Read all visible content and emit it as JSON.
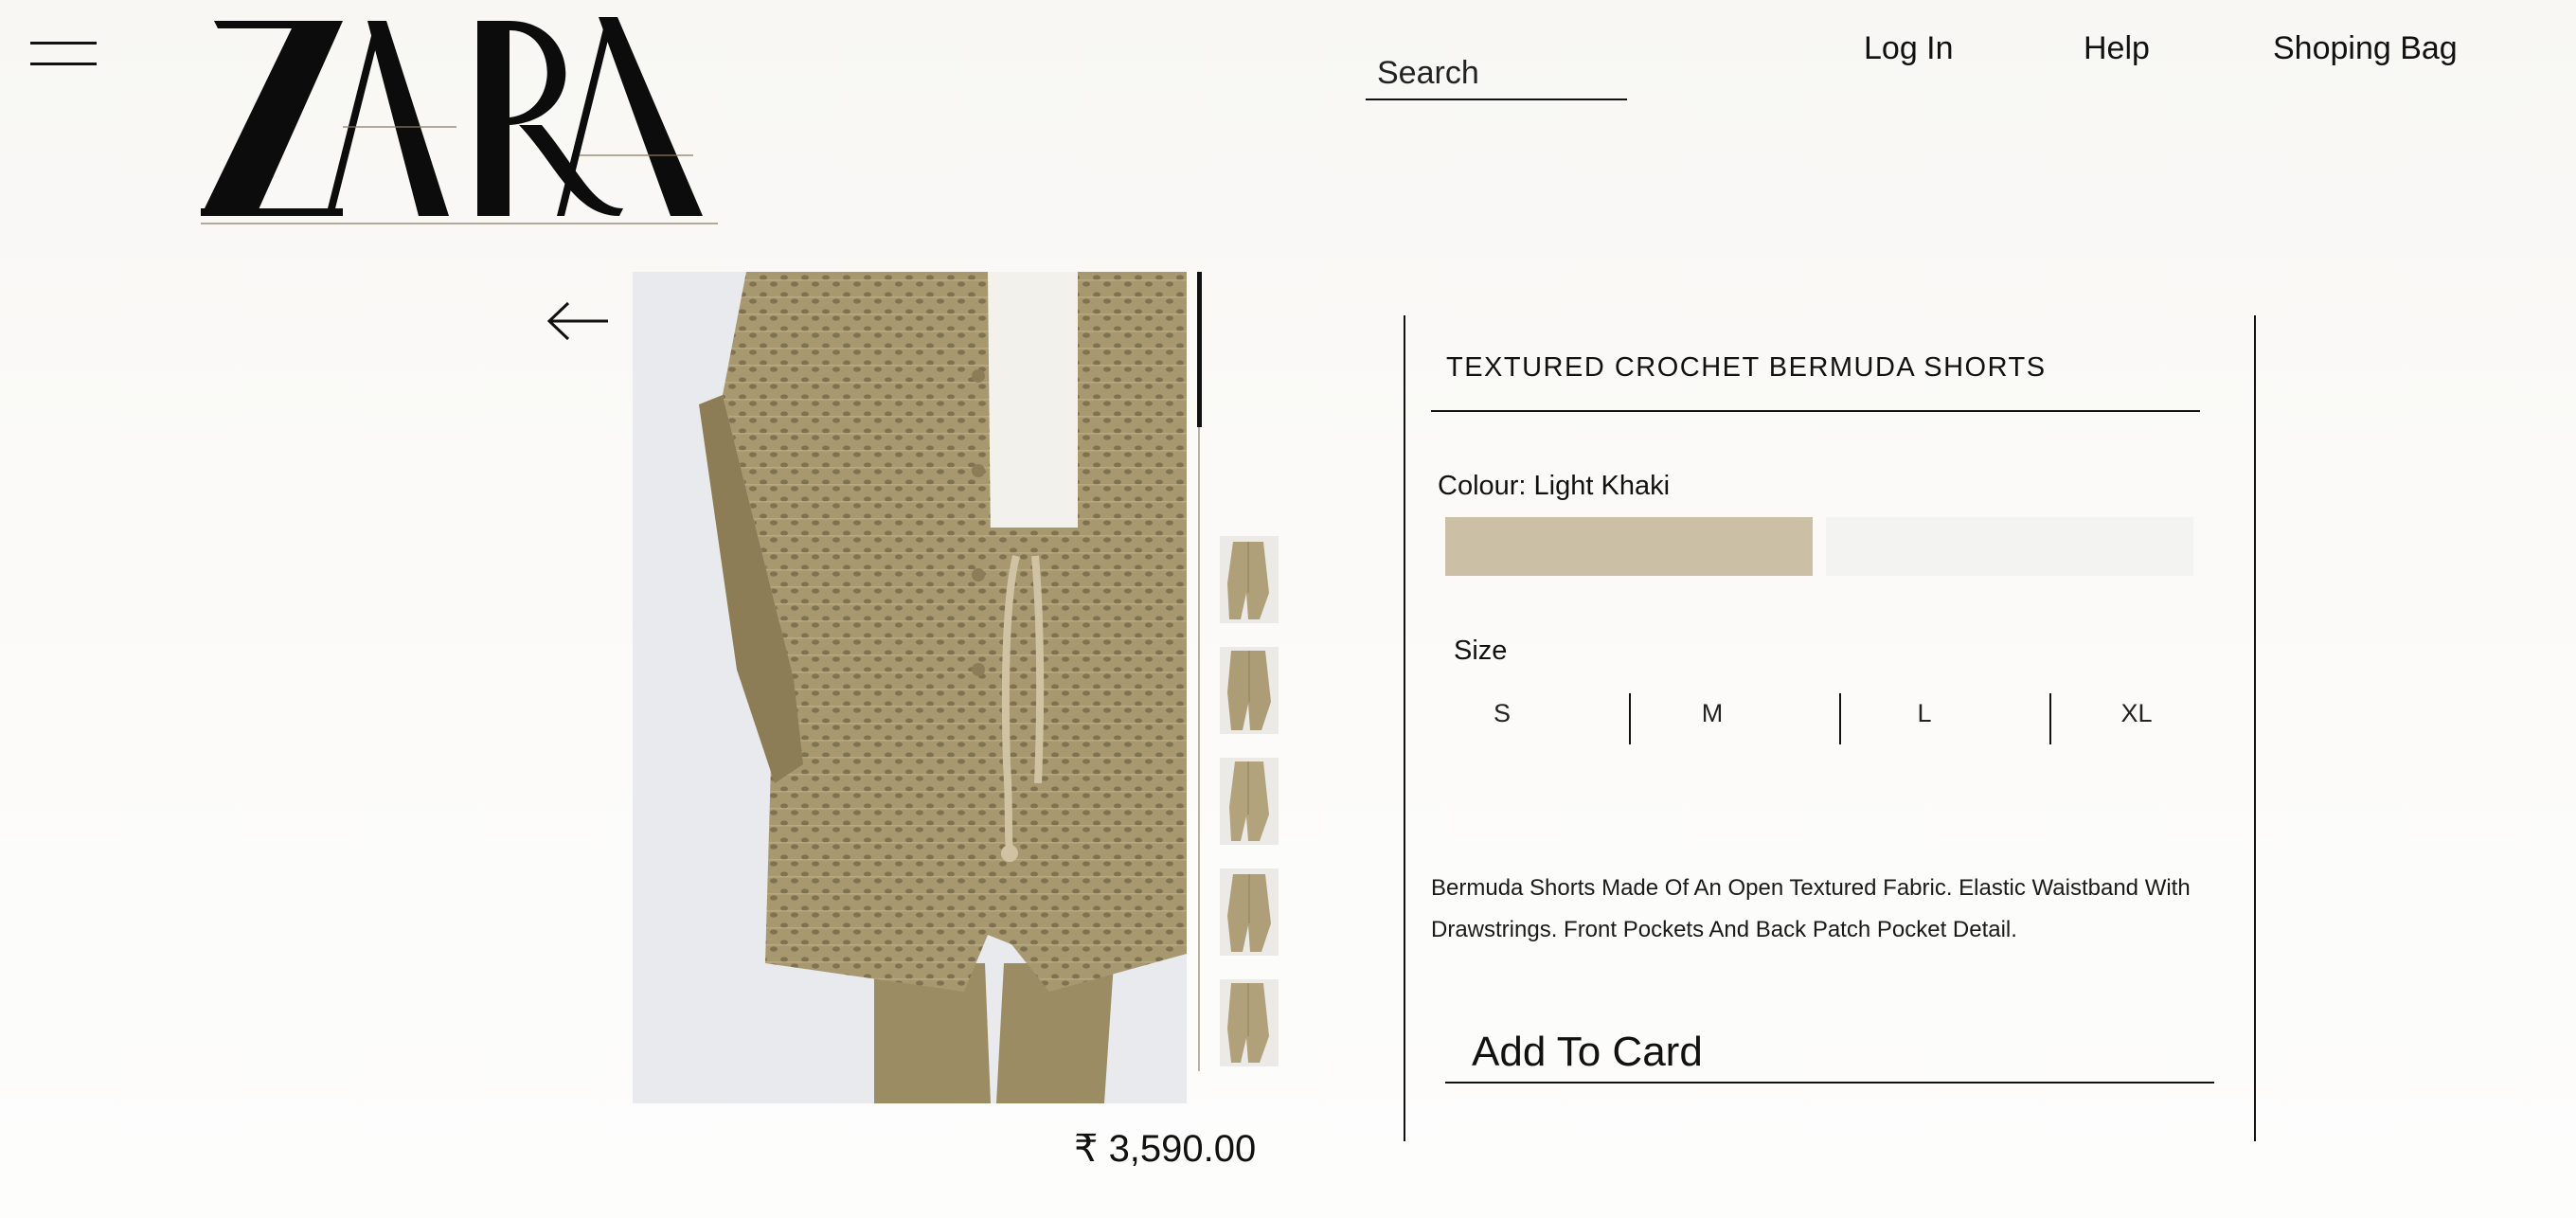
{
  "header": {
    "brand": "ZARA",
    "search_placeholder": "Search",
    "nav": {
      "login": "Log In",
      "help": "Help",
      "bag": "Shoping Bag"
    }
  },
  "gallery": {
    "thumbnail_count": 5,
    "scroll_position_fraction": 0.19
  },
  "product": {
    "title": "TEXTURED CROCHET BERMUDA SHORTS",
    "colour_label": "Colour: Light Khaki",
    "swatches": [
      {
        "name": "Light Khaki",
        "color": "#cbbfa6",
        "selected": true
      },
      {
        "name": "",
        "color": "#f3f3f2",
        "selected": false
      }
    ],
    "size_label": "Size",
    "sizes": [
      "S",
      "M",
      "L",
      "XL"
    ],
    "description": "Bermuda Shorts Made Of An Open Textured Fabric. Elastic Waistband With Drawstrings. Front Pockets And Back Patch Pocket Detail.",
    "add_button": "Add To Card",
    "price": "₹ 3,590.00"
  },
  "colors": {
    "accent": "#111111",
    "khaki": "#a8986f",
    "image_background": "#e9eaee"
  }
}
